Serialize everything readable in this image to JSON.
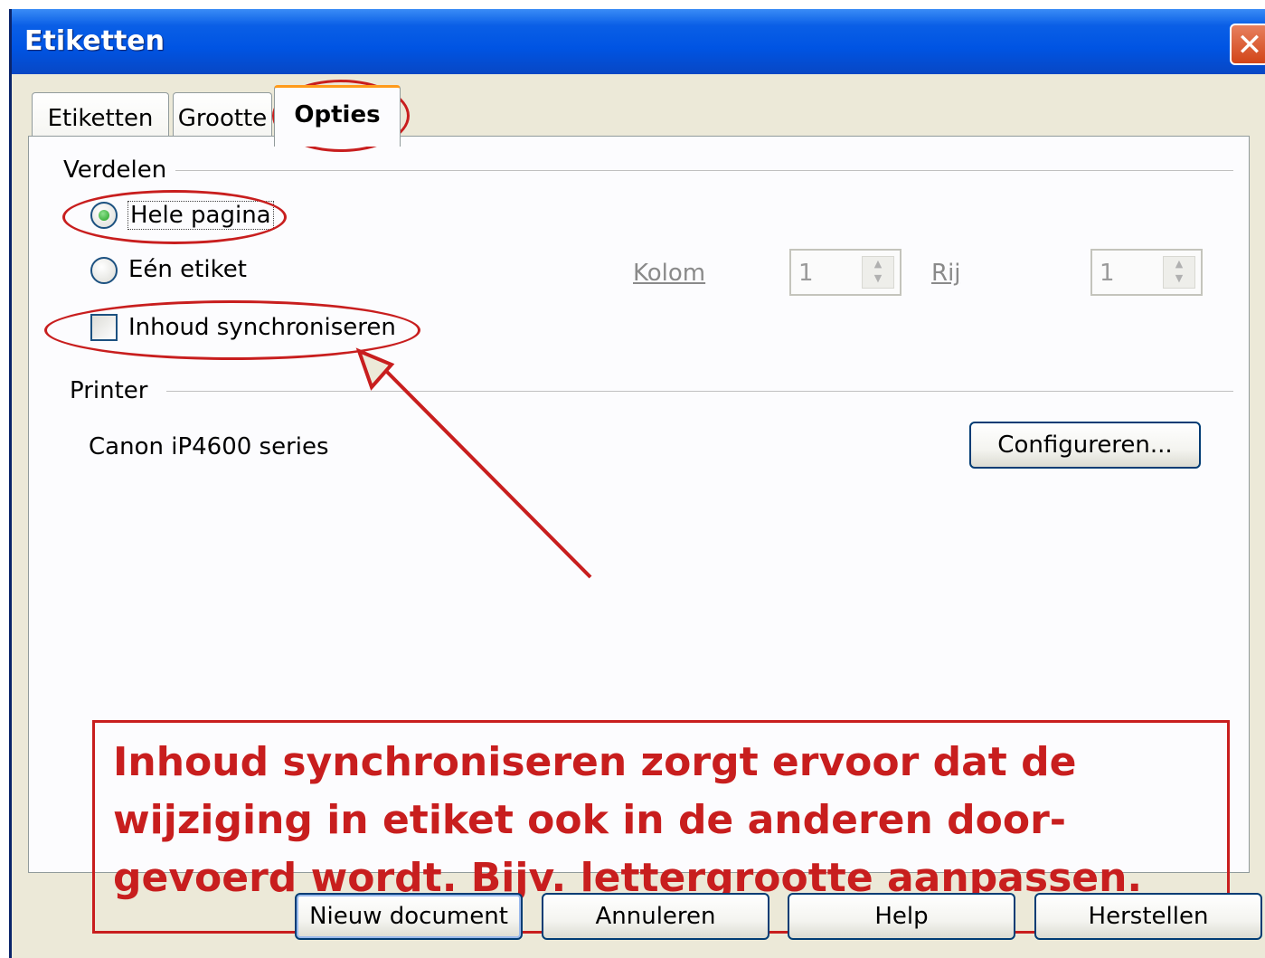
{
  "window": {
    "title": "Etiketten",
    "close_label": "✕"
  },
  "tabs": [
    {
      "label": "Etiketten",
      "active": false
    },
    {
      "label": "Grootte",
      "active": false
    },
    {
      "label": "Opties",
      "active": true
    }
  ],
  "verdelen": {
    "heading": "Verdelen",
    "options": [
      {
        "label": "Hele pagina",
        "selected": true
      },
      {
        "label": "Eén etiket",
        "selected": false
      }
    ],
    "sync_label": "Inhoud synchroniseren",
    "sync_checked": false,
    "kolom_label": "Kolom",
    "kolom_value": "1",
    "rij_label": "Rij",
    "rij_value": "1"
  },
  "printer": {
    "heading": "Printer",
    "name": "Canon iP4600 series",
    "configure_label": "Configureren..."
  },
  "annotation": {
    "text": "Inhoud synchroniseren zorgt ervoor dat de wijziging in etiket ook in de anderen door-gevoerd wordt. Bijv. lettergrootte aanpassen.",
    "color": "#c81e1e"
  },
  "buttons": {
    "new_document": "Nieuw document",
    "cancel": "Annuleren",
    "help": "Help",
    "reset": "Herstellen"
  }
}
